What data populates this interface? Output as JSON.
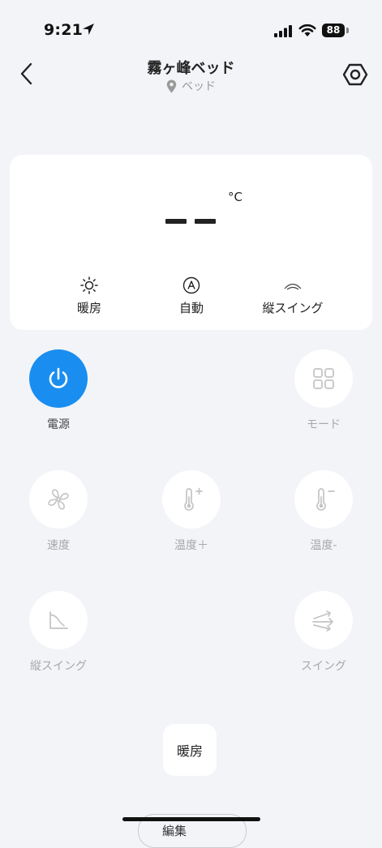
{
  "status_bar": {
    "time": "9:21",
    "battery": "88"
  },
  "header": {
    "title": "霧ヶ峰ベッド",
    "location": "ベッド"
  },
  "display": {
    "temperature": "",
    "unit": "°C",
    "modes": [
      {
        "label": "暖房",
        "icon": "sun-icon"
      },
      {
        "label": "自動",
        "icon": "auto-a-icon"
      },
      {
        "label": "縦スイング",
        "icon": "vertical-swing-icon"
      }
    ]
  },
  "controls": {
    "power": "電源",
    "mode": "モード",
    "speed": "速度",
    "temp_up": "温度＋",
    "temp_down": "温度-",
    "vertical_swing": "縦スイング",
    "swing": "スイング"
  },
  "quick": {
    "heat": "暖房"
  },
  "footer": {
    "edit": "編集"
  },
  "colors": {
    "accent": "#1a8ef0",
    "background": "#f2f4f8",
    "disabled_text": "#a8a8a8"
  }
}
